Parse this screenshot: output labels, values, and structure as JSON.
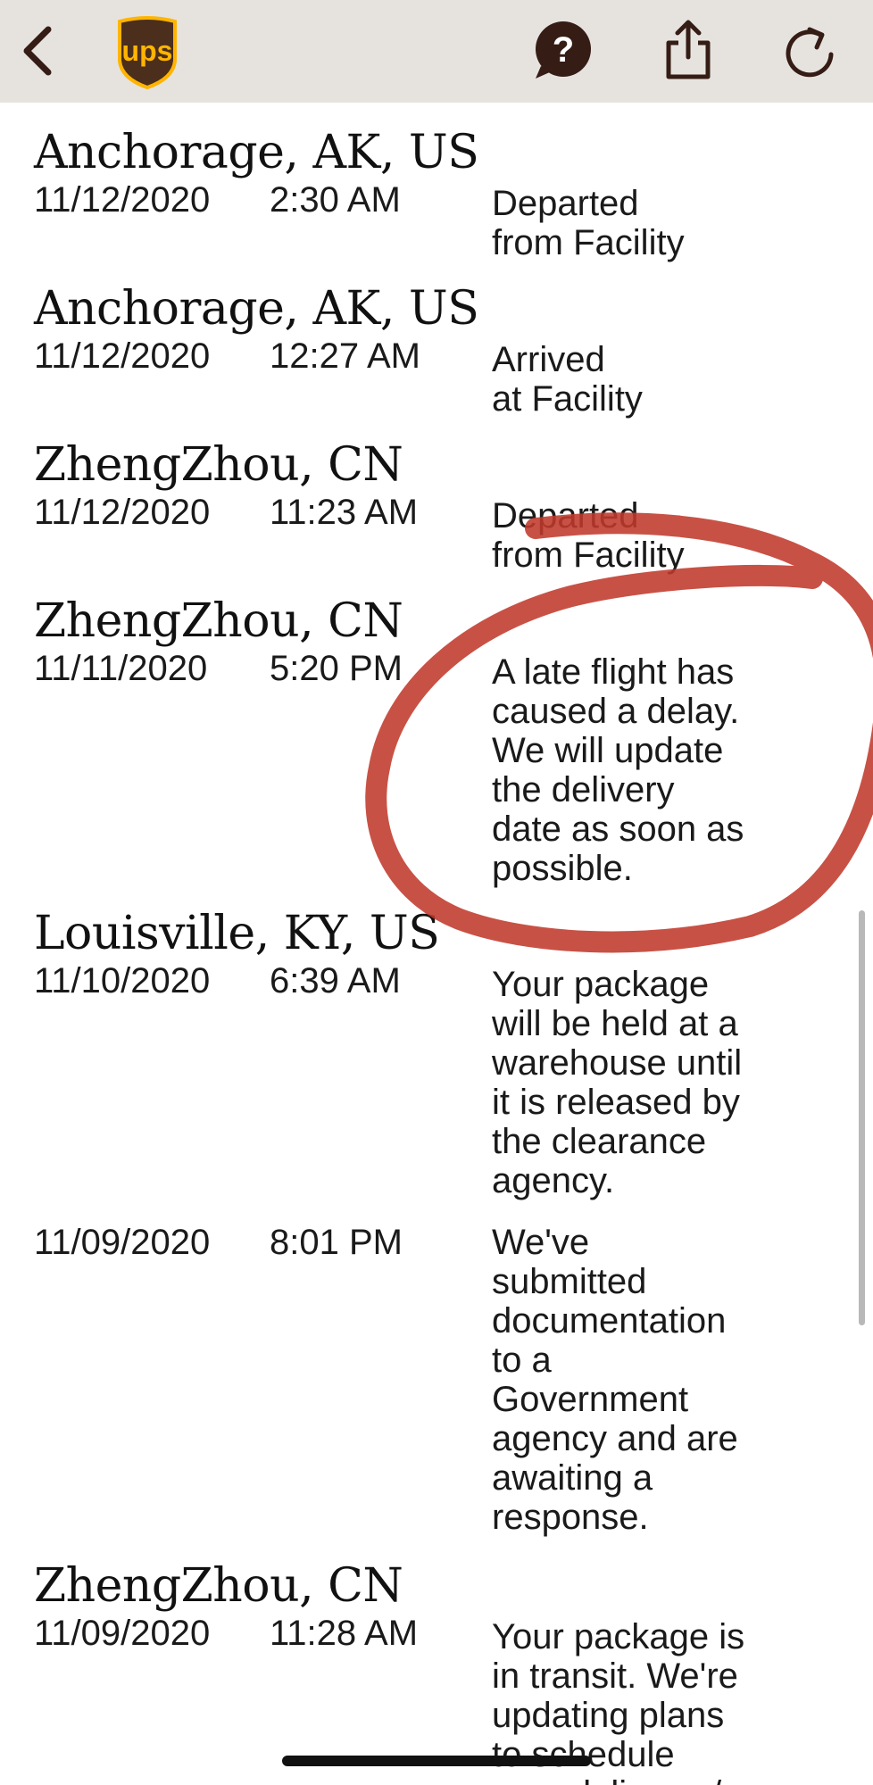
{
  "app": {
    "icons": {
      "back": "chevron-left-icon",
      "logo": "ups-logo",
      "help": "help-icon",
      "share": "share-icon",
      "refresh": "refresh-icon"
    },
    "logo_text": "ups",
    "help_glyph": "?",
    "colors": {
      "topbar": "#e6e3df",
      "icon": "#351c15",
      "logo_gold": "#ffb500",
      "logo_brown": "#4b2e1c",
      "annotation_red": "#c0392b"
    }
  },
  "tracking": {
    "entries": [
      {
        "location": "Anchorage, AK, US",
        "date": "11/12/2020",
        "time": "2:30 AM",
        "status": "Departed\nfrom Facility"
      },
      {
        "location": "Anchorage, AK, US",
        "date": "11/12/2020",
        "time": "12:27 AM",
        "status": "Arrived\nat Facility"
      },
      {
        "location": "ZhengZhou, CN",
        "date": "11/12/2020",
        "time": "11:23 AM",
        "status": "Departed\nfrom Facility"
      },
      {
        "location": "ZhengZhou, CN",
        "date": "11/11/2020",
        "time": "5:20 PM",
        "status": "A late flight has\ncaused a delay.\nWe will update\nthe delivery\ndate as soon as\npossible."
      },
      {
        "location": "Louisville, KY, US",
        "date": "11/10/2020",
        "time": "6:39 AM",
        "status": "Your package\nwill be held at a\nwarehouse until\nit is released by\nthe clearance\nagency."
      },
      {
        "location": "",
        "date": "11/09/2020",
        "time": "8:01 PM",
        "status": "We've\nsubmitted\ndocumentation\nto a\nGovernment\nagency and are\nawaiting a\nresponse."
      },
      {
        "location": "ZhengZhou, CN",
        "date": "11/09/2020",
        "time": "11:28 AM",
        "status": "Your package is\nin transit. We're\nupdating plans\nto schedule\nyour delivery. /"
      }
    ]
  }
}
